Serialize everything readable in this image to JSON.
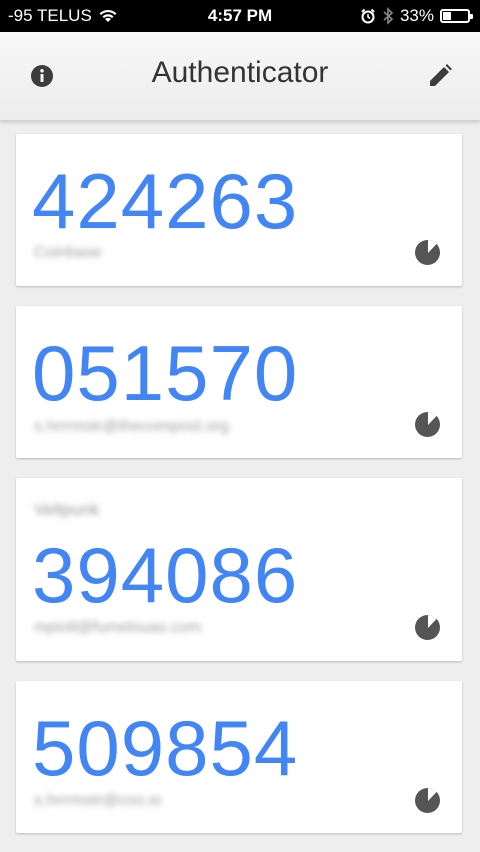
{
  "status_bar": {
    "carrier": "-95 TELUS",
    "time": "4:57 PM",
    "battery_percent": "33%",
    "battery_level": 0.33
  },
  "app_bar": {
    "title": "Authenticator",
    "info_icon": "info-icon",
    "edit_icon": "pencil-icon"
  },
  "colors": {
    "code": "#4285f4",
    "timer": "#555555",
    "background": "#eeeeee"
  },
  "accounts": [
    {
      "issuer": "",
      "code": "424263",
      "account": "Coinbase",
      "timer_elapsed": 0.12
    },
    {
      "issuer": "",
      "code": "051570",
      "account": "s.hrrrmstr@thecompost.org",
      "timer_elapsed": 0.12
    },
    {
      "issuer": "Veltpunk",
      "code": "394086",
      "account": "mpiotl@fumelouas.com",
      "timer_elapsed": 0.12
    },
    {
      "issuer": "",
      "code": "509854",
      "account": "s.hrrrmstr@coo.io",
      "timer_elapsed": 0.12
    }
  ]
}
